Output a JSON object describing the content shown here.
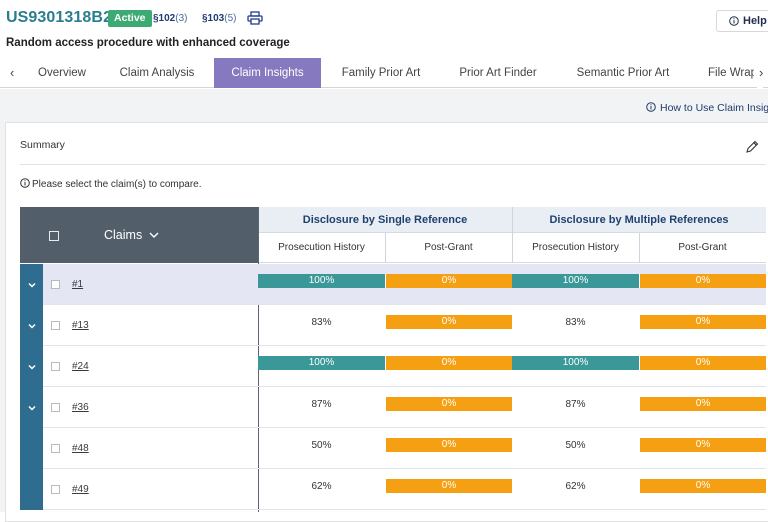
{
  "header": {
    "patent_number": "US9301318B2",
    "status": "Active",
    "statutes": [
      {
        "section": "§102",
        "count": "(3)"
      },
      {
        "section": "§103",
        "count": "(5)"
      }
    ],
    "help_label": "Help",
    "title": "Random access procedure with enhanced coverage"
  },
  "tabs": {
    "prev_arrow": "‹",
    "next_arrow": "›",
    "items": [
      "Overview",
      "Claim Analysis",
      "Claim Insights",
      "Family Prior Art",
      "Prior Art Finder",
      "Semantic Prior Art",
      "File Wrap"
    ],
    "active": "Claim Insights"
  },
  "how_to_link": "How to Use Claim Insights",
  "summary": {
    "title": "Summary",
    "note": "Please select the claim(s) to compare."
  },
  "table": {
    "claims_header": "Claims",
    "groups": [
      "Disclosure by Single Reference",
      "Disclosure by Multiple References"
    ],
    "subheaders": [
      "Prosecution History",
      "Post-Grant",
      "Prosecution History",
      "Post-Grant"
    ],
    "rows": [
      {
        "claim": "#1",
        "expandable": true,
        "selected": true,
        "single_pros": "100%",
        "single_post": "0%",
        "multi_pros": "100%",
        "multi_post": "0%"
      },
      {
        "claim": "#13",
        "expandable": true,
        "selected": false,
        "single_pros": "83%",
        "single_post": "0%",
        "multi_pros": "83%",
        "multi_post": "0%"
      },
      {
        "claim": "#24",
        "expandable": true,
        "selected": false,
        "single_pros": "100%",
        "single_post": "0%",
        "multi_pros": "100%",
        "multi_post": "0%"
      },
      {
        "claim": "#36",
        "expandable": true,
        "selected": false,
        "single_pros": "87%",
        "single_post": "0%",
        "multi_pros": "87%",
        "multi_post": "0%"
      },
      {
        "claim": "#48",
        "expandable": false,
        "selected": false,
        "single_pros": "50%",
        "single_post": "0%",
        "multi_pros": "50%",
        "multi_post": "0%"
      },
      {
        "claim": "#49",
        "expandable": false,
        "selected": false,
        "single_pros": "62%",
        "single_post": "0%",
        "multi_pros": "62%",
        "multi_post": "0%"
      }
    ]
  },
  "colors": {
    "brand_teal": "#2a7d8e",
    "active_badge": "#3daa74",
    "active_tab": "#8779bf",
    "prosecution_bar": "#3a9898",
    "post_grant_bar": "#f5a012",
    "row_strip": "#2e6d90"
  },
  "icons": {
    "print": "print-icon",
    "help": "info-icon",
    "edit": "pencil-icon",
    "expand": "chevron-down-icon"
  }
}
